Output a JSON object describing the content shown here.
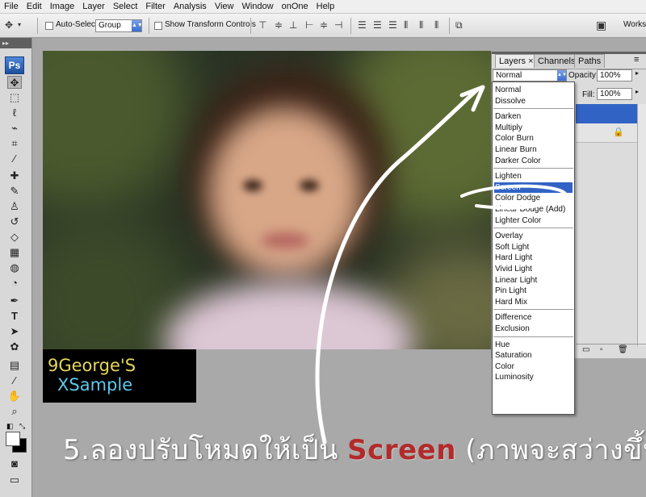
{
  "menu": [
    "File",
    "Edit",
    "Image",
    "Layer",
    "Select",
    "Filter",
    "Analysis",
    "View",
    "Window",
    "onOne",
    "Help"
  ],
  "options": {
    "auto_select_label": "Auto-Select:",
    "auto_select_value": "Group",
    "show_transform_label": "Show Transform Controls",
    "workspace_label": "Works"
  },
  "tools": {
    "logo": "Ps",
    "icons": [
      "move-tool",
      "marquee-tool",
      "lasso-tool",
      "quick-select-tool",
      "crop-tool",
      "eyedropper-tool",
      "healing-brush-tool",
      "brush-tool",
      "clone-stamp-tool",
      "history-brush-tool",
      "eraser-tool",
      "gradient-tool",
      "blur-tool",
      "dodge-tool",
      "pen-tool",
      "type-tool",
      "path-select-tool",
      "shape-tool",
      "notes-tool",
      "eyedropper-3d-tool",
      "hand-tool",
      "zoom-tool"
    ]
  },
  "watermark": {
    "line1": "9George'S",
    "line2": "XSample"
  },
  "layers_panel": {
    "tabs": [
      "Layers",
      "Channels",
      "Paths"
    ],
    "blend_mode": "Normal",
    "opacity_label": "Opacity:",
    "opacity_value": "100%",
    "fill_label": "Fill:",
    "fill_value": "100%"
  },
  "blend_modes": [
    [
      "Normal",
      "Dissolve"
    ],
    [
      "Darken",
      "Multiply",
      "Color Burn",
      "Linear Burn",
      "Darker Color"
    ],
    [
      "Lighten",
      "Screen",
      "Color Dodge",
      "Linear Dodge (Add)",
      "Lighter Color"
    ],
    [
      "Overlay",
      "Soft Light",
      "Hard Light",
      "Vivid Light",
      "Linear Light",
      "Pin Light",
      "Hard Mix"
    ],
    [
      "Difference",
      "Exclusion"
    ],
    [
      "Hue",
      "Saturation",
      "Color",
      "Luminosity"
    ]
  ],
  "selected_blend_mode": "Screen",
  "caption": {
    "prefix": "5.ลองปรับโหมดให้เป็น",
    "highlight": "Screen",
    "suffix": "(ภาพจะสว่างขึ้น)"
  },
  "colors": {
    "highlight": "#3163c5",
    "caption_highlight": "#b22b2b"
  }
}
